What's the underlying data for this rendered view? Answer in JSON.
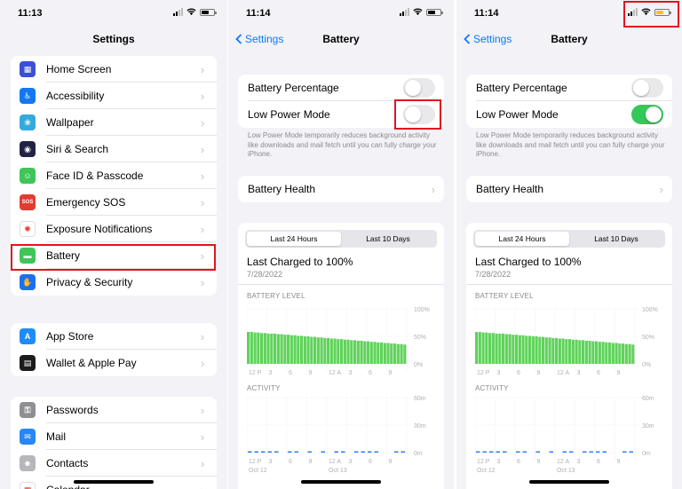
{
  "colors": {
    "accent": "#0a7aff",
    "highlight_box": "#e0141e",
    "toggle_on": "#34c759",
    "battery_bar": "#5fd35a",
    "activity_bar": "#2f7cf6"
  },
  "settings_screen": {
    "time": "11:13",
    "title": "Settings",
    "group1": [
      {
        "label": "Home Screen",
        "icon": "home-screen-icon",
        "color": "#3b4fd8",
        "glyph": "▦"
      },
      {
        "label": "Accessibility",
        "icon": "accessibility-icon",
        "color": "#1378f2",
        "glyph": "♿"
      },
      {
        "label": "Wallpaper",
        "icon": "wallpaper-icon",
        "color": "#34aadc",
        "glyph": "❀"
      },
      {
        "label": "Siri & Search",
        "icon": "siri-icon",
        "color": "#222244",
        "glyph": "◉"
      },
      {
        "label": "Face ID & Passcode",
        "icon": "face-id-icon",
        "color": "#3fc55a",
        "glyph": "☺"
      },
      {
        "label": "Emergency SOS",
        "icon": "emergency-sos-icon",
        "color": "#e23b30",
        "glyph": "SOS"
      },
      {
        "label": "Exposure Notifications",
        "icon": "exposure-notifications-icon",
        "color": "#ffffff",
        "glyph": "✺"
      },
      {
        "label": "Battery",
        "icon": "battery-icon",
        "color": "#3fc55a",
        "glyph": "▬"
      },
      {
        "label": "Privacy & Security",
        "icon": "privacy-hand-icon",
        "color": "#1d6ff2",
        "glyph": "✋"
      }
    ],
    "group2": [
      {
        "label": "App Store",
        "icon": "app-store-icon",
        "color": "#1e8cf5",
        "glyph": "A"
      },
      {
        "label": "Wallet & Apple Pay",
        "icon": "wallet-icon",
        "color": "#1c1c1e",
        "glyph": "▤"
      }
    ],
    "group3": [
      {
        "label": "Passwords",
        "icon": "key-icon",
        "color": "#8e8e93",
        "glyph": "⚿"
      },
      {
        "label": "Mail",
        "icon": "mail-icon",
        "color": "#2a86f5",
        "glyph": "✉"
      },
      {
        "label": "Contacts",
        "icon": "contacts-icon",
        "color": "#b6b6bb",
        "glyph": "☻"
      },
      {
        "label": "Calendar",
        "icon": "calendar-icon",
        "color": "#ffffff",
        "glyph": "▦"
      }
    ]
  },
  "battery_screen_off": {
    "time": "11:14",
    "back_label": "Settings",
    "title": "Battery",
    "battery_percentage_label": "Battery Percentage",
    "battery_percentage_on": false,
    "low_power_label": "Low Power Mode",
    "low_power_on": false,
    "note": "Low Power Mode temporarily reduces background activity like downloads and mail fetch until you can fully charge your iPhone.",
    "battery_health_label": "Battery Health",
    "tab_24h": "Last 24 Hours",
    "tab_10d": "Last 10 Days",
    "last_charged": "Last Charged to 100%",
    "last_charged_date": "7/28/2022",
    "battery_level_title": "BATTERY LEVEL",
    "activity_title": "ACTIVITY"
  },
  "battery_screen_on": {
    "time": "11:14",
    "back_label": "Settings",
    "title": "Battery",
    "battery_percentage_label": "Battery Percentage",
    "battery_percentage_on": false,
    "low_power_label": "Low Power Mode",
    "low_power_on": true,
    "note": "Low Power Mode temporarily reduces background activity like downloads and mail fetch until you can fully charge your iPhone.",
    "battery_health_label": "Battery Health",
    "tab_24h": "Last 24 Hours",
    "tab_10d": "Last 10 Days",
    "last_charged": "Last Charged to 100%",
    "last_charged_date": "7/28/2022",
    "battery_level_title": "BATTERY LEVEL",
    "activity_title": "ACTIVITY"
  },
  "chart_data": [
    {
      "type": "bar",
      "title": "BATTERY LEVEL",
      "y_ticks": [
        "100%",
        "50%",
        "0%"
      ],
      "ylim": [
        0,
        100
      ],
      "x_ticks": [
        "12 P",
        "3",
        "6",
        "9",
        "12 A",
        "3",
        "6",
        "9"
      ],
      "values": [
        58,
        58,
        57,
        57,
        56,
        56,
        55,
        55,
        55,
        54,
        54,
        53,
        53,
        52,
        52,
        51,
        51,
        50,
        50,
        49,
        49,
        48,
        48,
        47,
        47,
        46,
        46,
        45,
        45,
        44,
        44,
        43,
        43,
        42,
        42,
        41,
        41,
        40,
        40,
        39,
        39,
        38,
        38,
        37,
        37,
        36,
        36,
        35
      ]
    },
    {
      "type": "bar",
      "title": "ACTIVITY",
      "y_ticks": [
        "60m",
        "30m",
        "0m"
      ],
      "ylim": [
        0,
        60
      ],
      "x_ticks": [
        "12 P",
        "3",
        "6",
        "9",
        "12 A",
        "3",
        "6",
        "9"
      ],
      "x_sub_ticks": [
        "Oct 12",
        "Oct 13"
      ],
      "values": [
        1,
        1,
        1,
        1,
        1,
        0,
        1,
        1,
        0,
        1,
        0,
        1,
        0,
        1,
        1,
        0,
        1,
        1,
        1,
        1,
        0,
        0,
        1,
        1
      ]
    }
  ]
}
